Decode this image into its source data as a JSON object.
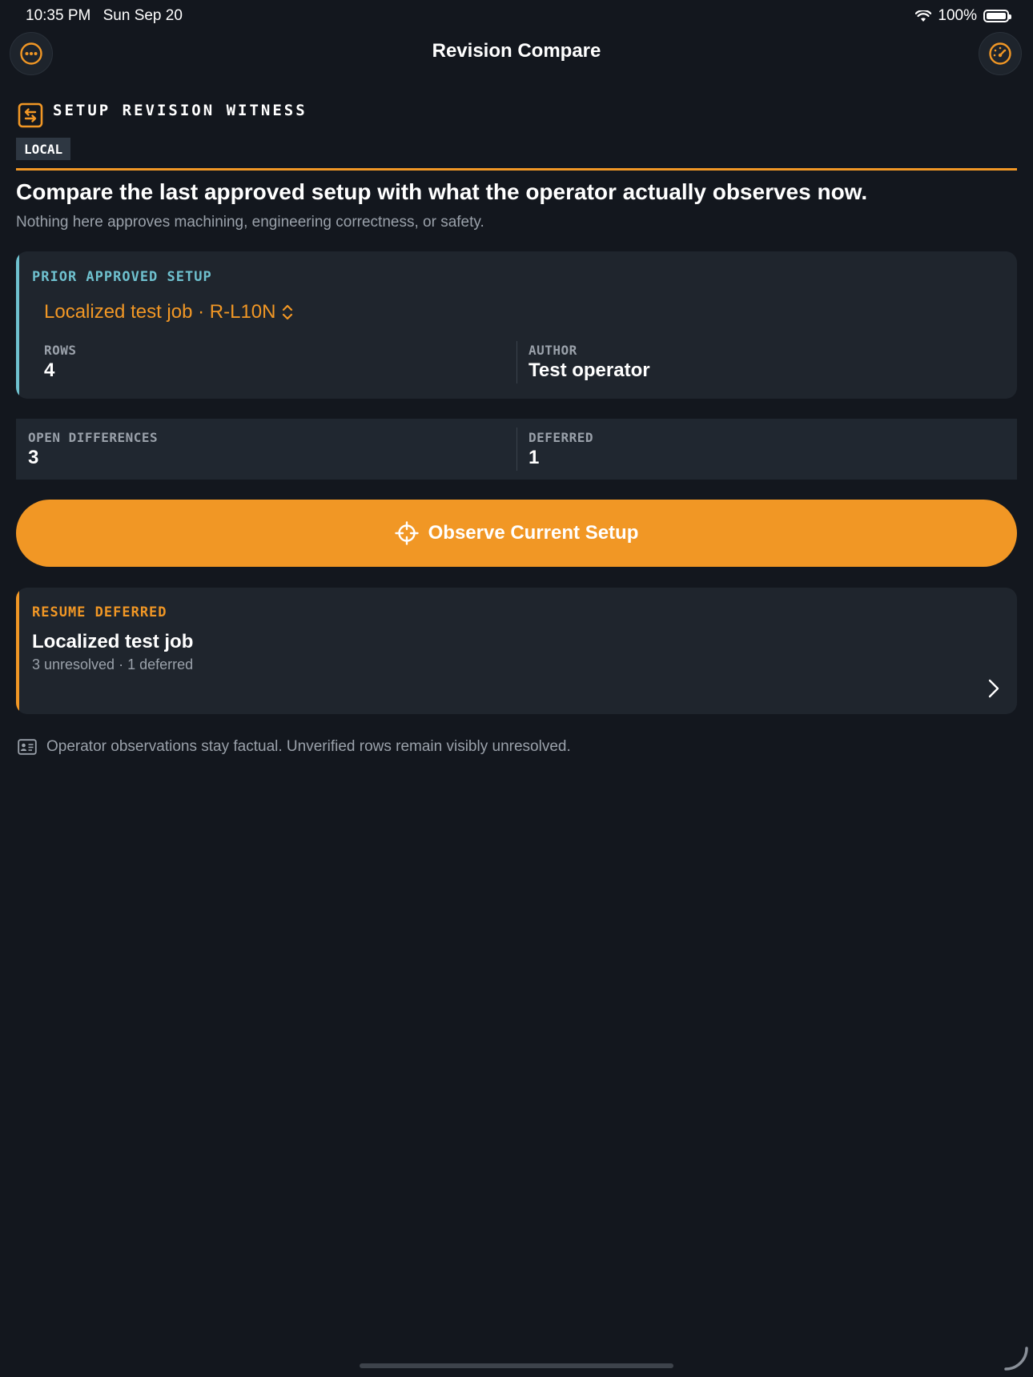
{
  "status_bar": {
    "time": "10:35 PM",
    "date": "Sun Sep 20",
    "battery": "100%"
  },
  "nav": {
    "title": "Revision Compare",
    "left_icon": "ellipsis-circle-icon",
    "right_icon": "gauge-icon"
  },
  "section": {
    "icon": "swap-square-icon",
    "title": "SETUP REVISION WITNESS",
    "badge": "LOCAL"
  },
  "intro": {
    "headline": "Compare the last approved setup with what the operator actually observes now.",
    "subline": "Nothing here approves machining, engineering correctness, or safety."
  },
  "prior_setup": {
    "eyebrow": "PRIOR APPROVED SETUP",
    "selected": "Localized test job · R-L10N",
    "rows_label": "ROWS",
    "rows_value": "4",
    "author_label": "AUTHOR",
    "author_value": "Test operator"
  },
  "summary": {
    "open_label": "OPEN DIFFERENCES",
    "open_value": "3",
    "deferred_label": "DEFERRED",
    "deferred_value": "1"
  },
  "cta": {
    "label": "Observe Current Setup",
    "icon": "crosshair-icon"
  },
  "resume": {
    "eyebrow": "RESUME DEFERRED",
    "title": "Localized test job",
    "detail": "3 unresolved · 1 deferred"
  },
  "footnote": {
    "icon": "id-card-icon",
    "text": "Operator observations stay factual. Unverified rows remain visibly unresolved."
  },
  "colors": {
    "accent": "#f19725",
    "teal": "#6fc1cf",
    "background": "#13171e",
    "card": "#1f252d"
  }
}
